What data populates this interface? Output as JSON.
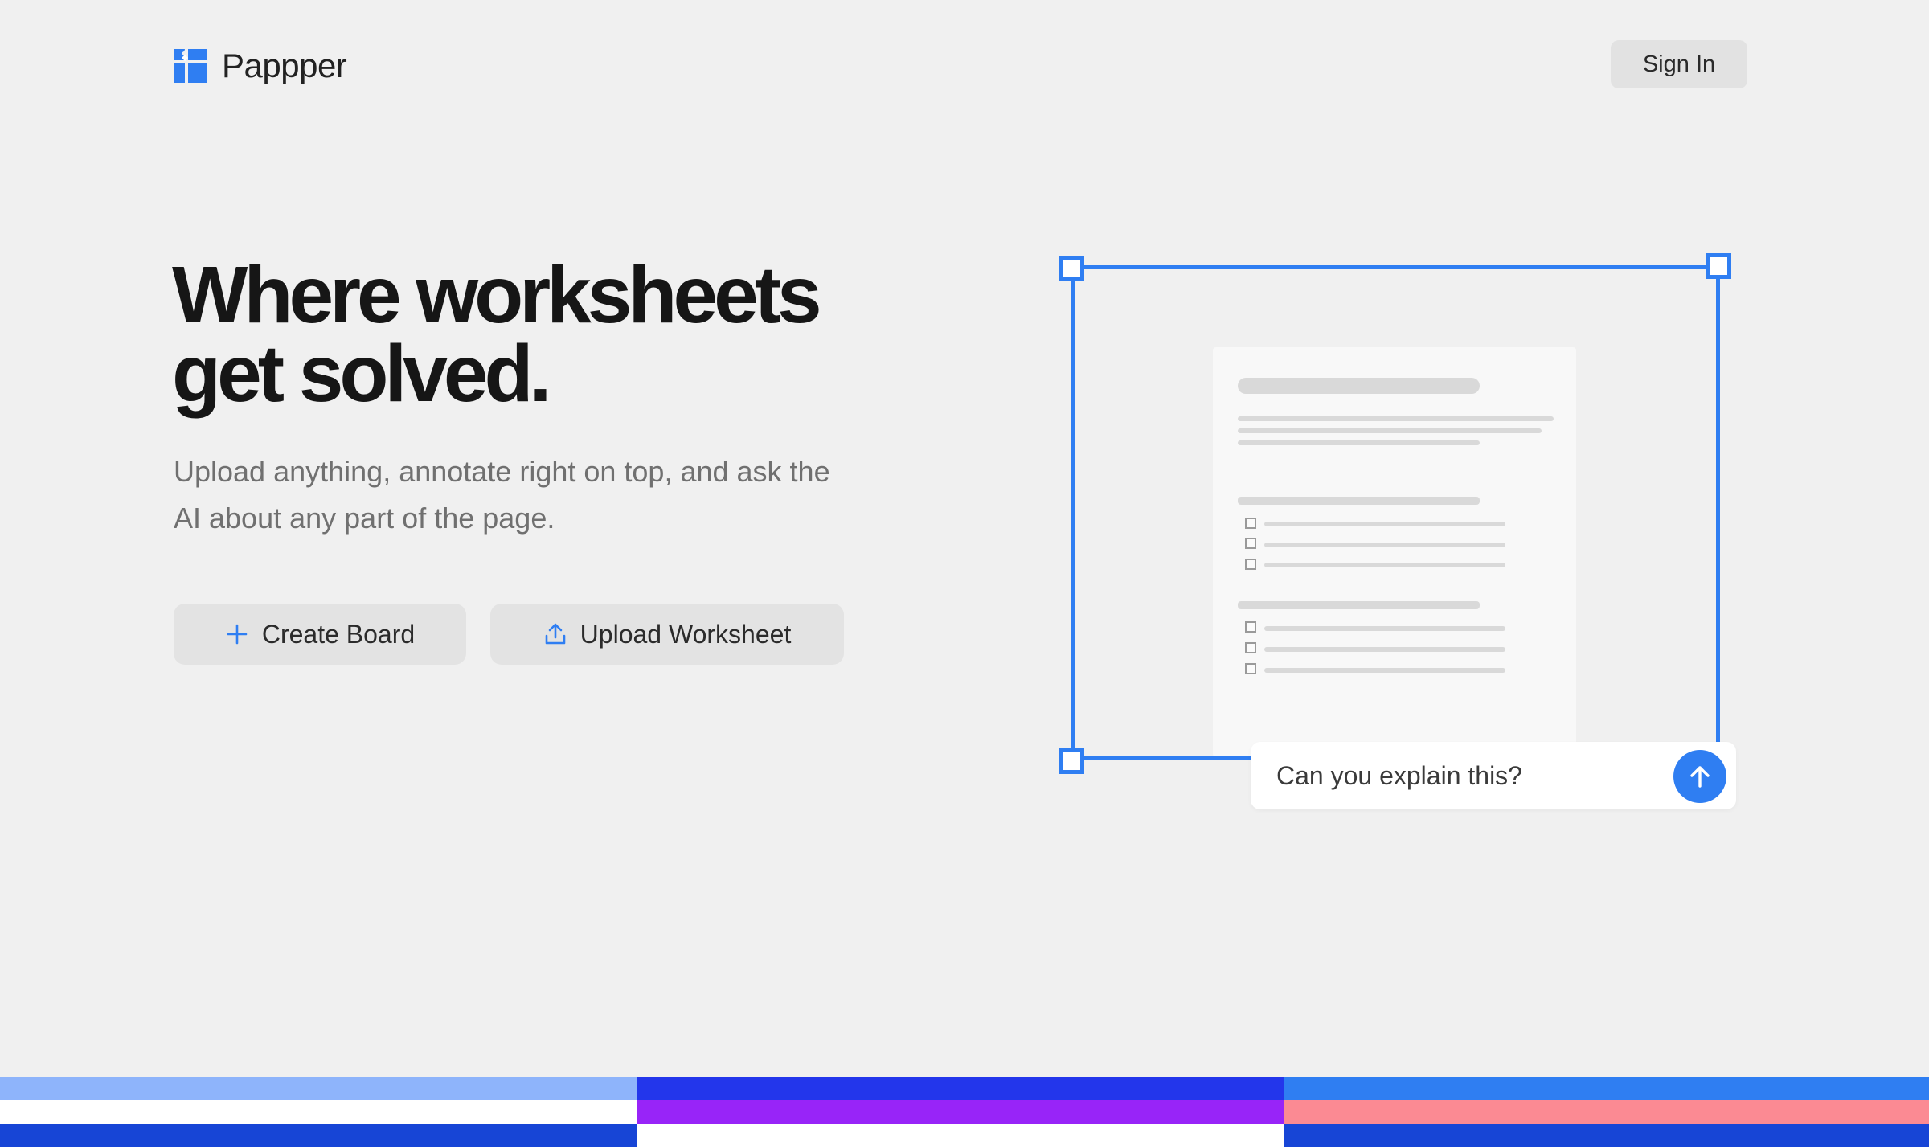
{
  "header": {
    "brand": "Pappper",
    "sign_in_label": "Sign In"
  },
  "hero": {
    "headline_line1": "Where worksheets",
    "headline_line2": "get solved.",
    "subtitle": "Upload anything, annotate right on top, and ask the AI about any part of the page.",
    "create_board_label": "Create Board",
    "upload_worksheet_label": "Upload Worksheet"
  },
  "illustration": {
    "chat_prompt": "Can you explain this?"
  },
  "icons": {
    "logo": "pappper-logo-icon",
    "create": "plus-icon",
    "upload": "upload-icon",
    "send": "arrow-up-icon"
  },
  "colors": {
    "accent": "#2f7ef2",
    "background": "#f0f0f0",
    "stripes": [
      [
        "#8eb4fb",
        "#ffffff",
        "#1745d6"
      ],
      [
        "#2336eb",
        "#9824f8",
        "#ffffff"
      ],
      [
        "#2f7ef2",
        "#fb8a93",
        "#1745d6"
      ]
    ]
  }
}
